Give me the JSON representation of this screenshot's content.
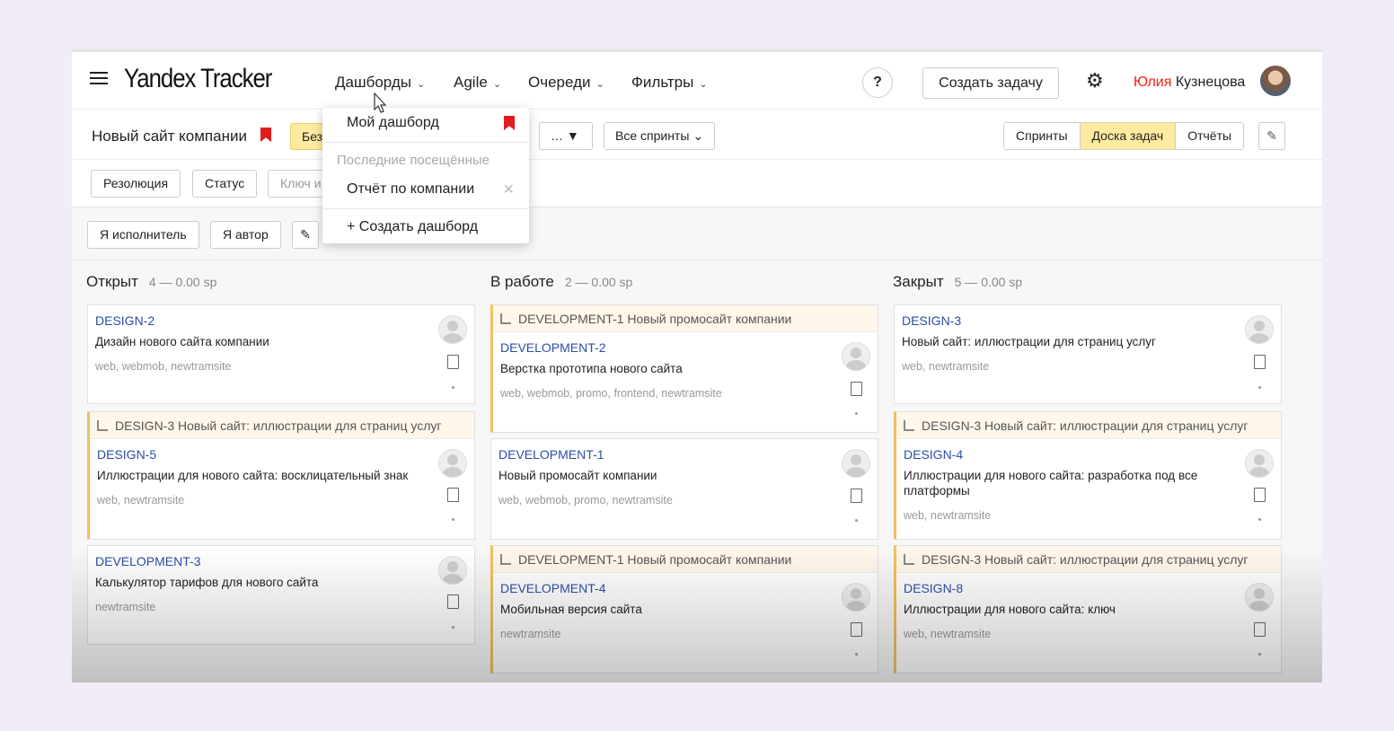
{
  "header": {
    "logo": "Yandex Tracker",
    "nav": [
      {
        "label": "Дашборды"
      },
      {
        "label": "Agile"
      },
      {
        "label": "Очереди"
      },
      {
        "label": "Фильтры"
      }
    ],
    "help_label": "?",
    "create_task_label": "Создать задачу",
    "user_first": "Юлия",
    "user_last": " Кузнецова"
  },
  "board": {
    "title": "Новый сайт компании",
    "chip_label": "Без",
    "more_label": "… ▼",
    "sprints_select": "Все спринты",
    "views": [
      "Спринты",
      "Доска задач",
      "Отчёты"
    ],
    "active_view": "Доска задач"
  },
  "filters": {
    "buttons": [
      "Резолюция",
      "Статус"
    ],
    "key_placeholder": "Ключ и",
    "quick": [
      "Я исполнитель",
      "Я автор"
    ]
  },
  "dropdown": {
    "my_dashboard": "Мой дашборд",
    "recent_label": "Последние посещённые",
    "recent_item": "Отчёт по компании",
    "create_label": "+  Создать дашборд"
  },
  "columns": [
    {
      "title": "Открыт",
      "count": "4 — 0.00 sp",
      "cards": [
        {
          "key": "DESIGN-2",
          "title": "Дизайн нового сайта компании",
          "tags": "web, webmob, newtramsite"
        },
        {
          "parent": "DESIGN-3 Новый сайт: иллюстрации для страниц услуг",
          "key": "DESIGN-5",
          "title": "Иллюстрации для нового сайта: восклицательный знак",
          "tags": "web, newtramsite"
        },
        {
          "key": "DEVELOPMENT-3",
          "title": "Калькулятор тарифов для нового сайта",
          "tags": "newtramsite"
        }
      ]
    },
    {
      "title": "В работе",
      "count": "2 — 0.00 sp",
      "cards": [
        {
          "parent": "DEVELOPMENT-1 Новый промосайт компании",
          "key": "DEVELOPMENT-2",
          "title": "Верстка прототипа нового сайта",
          "tags": "web, webmob, promo, frontend, newtramsite"
        },
        {
          "key": "DEVELOPMENT-1",
          "title": "Новый промосайт компании",
          "tags": "web, webmob, promo, newtramsite"
        },
        {
          "parent": "DEVELOPMENT-1 Новый промосайт компании",
          "key": "DEVELOPMENT-4",
          "title": "Мобильная версия сайта",
          "tags": "newtramsite"
        }
      ]
    },
    {
      "title": "Закрыт",
      "count": "5 — 0.00 sp",
      "cards": [
        {
          "key": "DESIGN-3",
          "title": "Новый сайт: иллюстрации для страниц услуг",
          "tags": "web, newtramsite"
        },
        {
          "parent": "DESIGN-3 Новый сайт: иллюстрации для страниц услуг",
          "key": "DESIGN-4",
          "title": "Иллюстрации для нового сайта: разработка под все платформы",
          "tags": "web, newtramsite"
        },
        {
          "parent": "DESIGN-3 Новый сайт: иллюстрации для страниц услуг",
          "key": "DESIGN-8",
          "title": "Иллюстрации для нового сайта: ключ",
          "tags": "web, newtramsite"
        }
      ]
    }
  ],
  "colors": {
    "accent_yellow": "#ffeba0",
    "link_blue": "#2b4ea8",
    "bookmark_red": "#e01d1d"
  }
}
